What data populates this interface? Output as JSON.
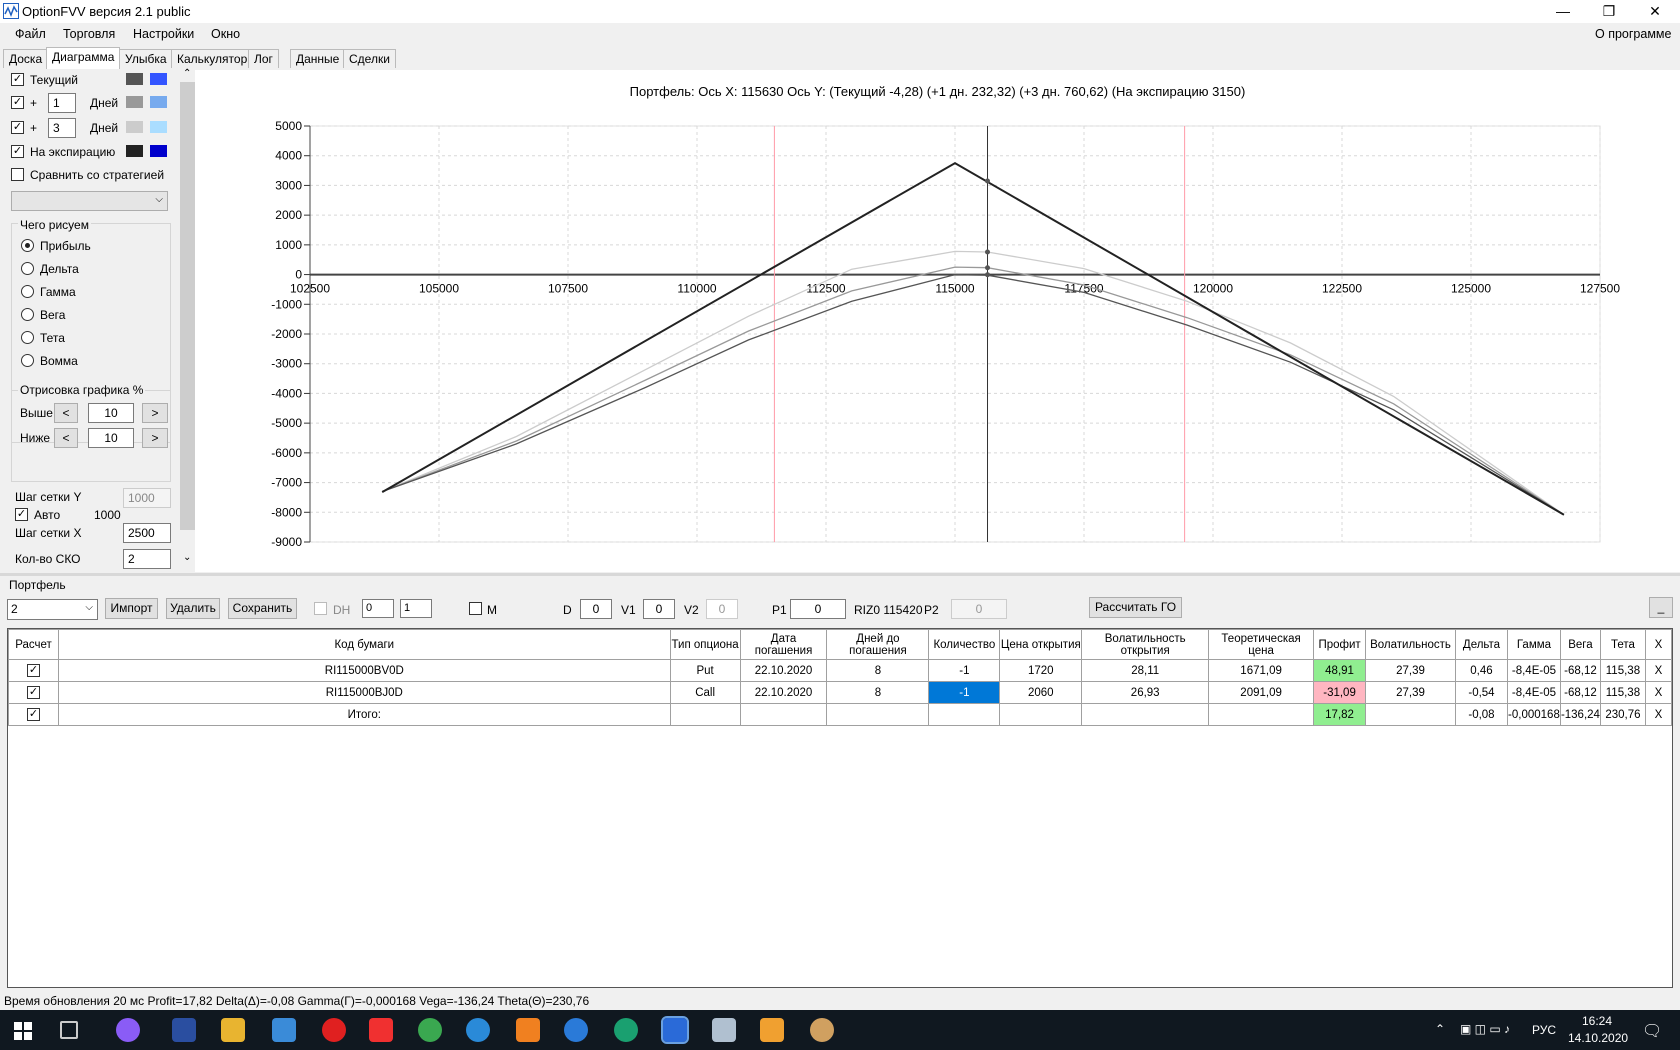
{
  "window": {
    "title": "OptionFVV версия 2.1 public",
    "minimize": "—",
    "restore": "❐",
    "close": "✕"
  },
  "menu": {
    "items": [
      "Файл",
      "Торговля",
      "Настройки",
      "Окно"
    ],
    "about": "О программе"
  },
  "tabs": [
    "Доска",
    "Диаграмма",
    "Улыбка",
    "Калькулятор",
    "Лог",
    "Данные",
    "Сделки"
  ],
  "active_tab": "Диаграмма",
  "left": {
    "row_current": "Текущий",
    "plus": "+",
    "days_1": "1",
    "days_label": "Дней",
    "days_3": "3",
    "expiration": "На экспирацию",
    "compare": "Сравнить со стратегией",
    "draw_group": "Чего рисуем",
    "draw_options": [
      "Прибыль",
      "Дельта",
      "Гамма",
      "Вега",
      "Тета",
      "Вомма"
    ],
    "render_group": "Отрисовка графика %",
    "above": "Выше",
    "below": "Ниже",
    "above_val": "10",
    "below_val": "10",
    "lt": "<",
    "gt": ">",
    "grid_y": "Шаг сетки Y",
    "grid_y_val": "1000",
    "auto": "Авто",
    "auto_val": "1000",
    "grid_x": "Шаг сетки X",
    "grid_x_val": "2500",
    "sko": "Кол-во СКО",
    "sko_val": "2",
    "colors": {
      "current": [
        "#555555",
        "#3355ff"
      ],
      "d1": [
        "#999999",
        "#77aaee"
      ],
      "d3": [
        "#cccccc",
        "#aaddff"
      ],
      "exp": [
        "#222222",
        "#0000cc"
      ]
    }
  },
  "chart_title": "Портфель: Ось X: 115630 Ось Y:  (Текущий -4,28)  (+1 дн. 232,32)  (+3 дн. 760,62)  (На экспирацию 3150)",
  "chart_data": {
    "type": "line",
    "xlim": [
      102500,
      127500
    ],
    "ylim": [
      -9000,
      5000
    ],
    "x_ticks": [
      "102500",
      "105000",
      "107500",
      "110000",
      "112500",
      "115000",
      "117500",
      "120000",
      "122500",
      "125000",
      "127500"
    ],
    "y_ticks": [
      "5000",
      "4000",
      "3000",
      "2000",
      "1000",
      "0",
      "-1000",
      "-2000",
      "-3000",
      "-4000",
      "-5000",
      "-6000",
      "-7000",
      "-8000",
      "-9000"
    ],
    "cursor_x": 115630,
    "sko_lines": [
      111500,
      119450
    ],
    "series": [
      {
        "points": [
          [
            103900,
            -7320
          ],
          [
            115000,
            3750
          ],
          [
            126800,
            -8080
          ]
        ],
        "color": "#222222"
      },
      {
        "points": [
          [
            103900,
            -7300
          ],
          [
            106500,
            -5700
          ],
          [
            109000,
            -3800
          ],
          [
            111000,
            -2200
          ],
          [
            113000,
            -900
          ],
          [
            115000,
            0
          ],
          [
            115630,
            -20
          ],
          [
            117500,
            -600
          ],
          [
            119500,
            -1700
          ],
          [
            121500,
            -2950
          ],
          [
            123500,
            -4550
          ],
          [
            126800,
            -8080
          ]
        ],
        "color": "#555555"
      },
      {
        "points": [
          [
            103900,
            -7300
          ],
          [
            106500,
            -5600
          ],
          [
            109000,
            -3550
          ],
          [
            111000,
            -1900
          ],
          [
            113000,
            -550
          ],
          [
            115000,
            250
          ],
          [
            115630,
            230
          ],
          [
            117500,
            -350
          ],
          [
            119500,
            -1450
          ],
          [
            121500,
            -2700
          ],
          [
            123500,
            -4350
          ],
          [
            126800,
            -8080
          ]
        ],
        "color": "#999999"
      },
      {
        "points": [
          [
            103900,
            -7300
          ],
          [
            106500,
            -5450
          ],
          [
            109000,
            -3200
          ],
          [
            111000,
            -1400
          ],
          [
            113000,
            180
          ],
          [
            115000,
            780
          ],
          [
            115630,
            760
          ],
          [
            117500,
            200
          ],
          [
            119500,
            -900
          ],
          [
            121500,
            -2300
          ],
          [
            123500,
            -4100
          ],
          [
            126800,
            -8080
          ]
        ],
        "color": "#cccccc"
      }
    ],
    "markers": [
      [
        115630,
        3150
      ],
      [
        115630,
        760
      ],
      [
        115630,
        230
      ],
      [
        115630,
        -4
      ]
    ]
  },
  "portfolio": {
    "label": "Портфель",
    "select": "2",
    "import": "Импорт",
    "delete": "Удалить",
    "save": "Сохранить",
    "dh": "DH",
    "dh_a": "0",
    "dh_b": "1",
    "m": "M",
    "d": "D",
    "d_val": "0",
    "v1": "V1",
    "v1_val": "0",
    "v2": "V2",
    "v2_val": "0",
    "p1": "P1",
    "p1_val": "0",
    "riz": "RIZ0 115420",
    "p2": "P2",
    "p2_val": "0",
    "calc_go": "Рассчитать ГО",
    "minimize": "_"
  },
  "table": {
    "headers": [
      "Расчет",
      "Код бумаги",
      "Тип опциона",
      "Дата погашения",
      "Дней до погашения",
      "Количество",
      "Цена открытия",
      "Волатильность открытия",
      "Теоретическая цена",
      "Профит",
      "Волатильность",
      "Дельта",
      "Гамма",
      "Вега",
      "Тета",
      "X"
    ],
    "rows": [
      [
        "RI115000BV0D",
        "Put",
        "22.10.2020",
        "8",
        "-1",
        "1720",
        "28,11",
        "1671,09",
        "48,91",
        "27,39",
        "0,46",
        "-8,4E-05",
        "-68,12",
        "115,38",
        "X"
      ],
      [
        "RI115000BJ0D",
        "Call",
        "22.10.2020",
        "8",
        "-1",
        "2060",
        "26,93",
        "2091,09",
        "-31,09",
        "27,39",
        "-0,54",
        "-8,4E-05",
        "-68,12",
        "115,38",
        "X"
      ],
      [
        "Итого:",
        "",
        "",
        "",
        "",
        "",
        "",
        "",
        "17,82",
        "",
        "-0,08",
        "-0,000168",
        "-136,24",
        "230,76",
        "X"
      ]
    ]
  },
  "status": "Время обновления 20 мс  Profit=17,82 Delta(Δ)=-0,08 Gamma(Γ)=-0,000168 Vega=-136,24 Theta(Θ)=230,76",
  "taskbar": {
    "lang": "РУС",
    "time": "16:24",
    "date": "14.10.2020"
  }
}
